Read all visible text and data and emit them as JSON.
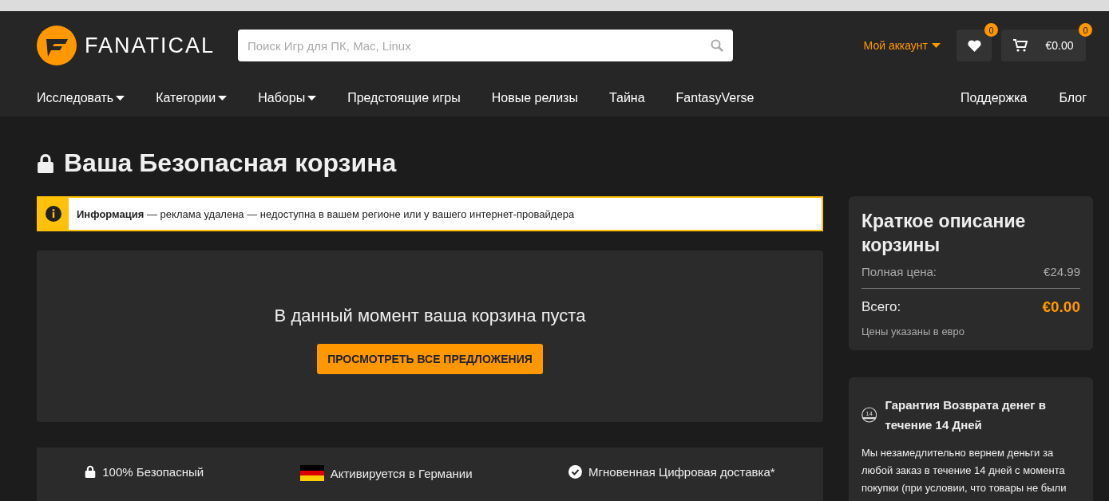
{
  "header": {
    "logo": "FANATICAL",
    "search": {
      "placeholder": "Поиск Игр для ПК, Mac, Linux"
    },
    "account": "Мой аккаунт",
    "wishlist_count": "0",
    "cart_count": "0",
    "cart_total": "€0.00"
  },
  "nav": {
    "left": [
      {
        "label": "Исследовать",
        "dropdown": true
      },
      {
        "label": "Категории",
        "dropdown": true
      },
      {
        "label": "Наборы",
        "dropdown": true
      },
      {
        "label": "Предстоящие игры",
        "dropdown": false
      },
      {
        "label": "Новые релизы",
        "dropdown": false
      },
      {
        "label": "Тайна",
        "dropdown": false
      },
      {
        "label": "FantasyVerse",
        "dropdown": false
      }
    ],
    "right": [
      {
        "label": "Поддержка",
        "dropdown": false
      },
      {
        "label": "Блог",
        "dropdown": false
      }
    ]
  },
  "page_title": "Ваша Безопасная корзина",
  "info_banner": "**Информация** — реклама удалена — недоступна в вашем регионе или у вашего интернет-провайдера",
  "cart": {
    "empty_message": "В данный момент ваша корзина пуста",
    "button": "ПРОСМОТРЕТЬ ВСЕ ПРЕДЛОЖЕНИЯ"
  },
  "features": [
    {
      "kind": "lock",
      "label": "100% Безопасный"
    },
    {
      "kind": "flag",
      "label": "Активируется в Германии"
    },
    {
      "kind": "check",
      "label": "Мгновенная Цифровая доставка*"
    }
  ],
  "summary": {
    "title": "Краткое описание корзины",
    "full_price_label": "Полная цена:",
    "full_price": "€24.99",
    "total_label": "Всего:",
    "total": "€0.00",
    "note": "Цены указаны в евро"
  },
  "guarantee": {
    "badge": "14",
    "title": "Гарантия Возврата денег в течение 14 Дней",
    "text": "Мы незамедлительно вернем деньги за любой заказ в течение 14 дней с момента покупки (при условии, что товары не были"
  }
}
